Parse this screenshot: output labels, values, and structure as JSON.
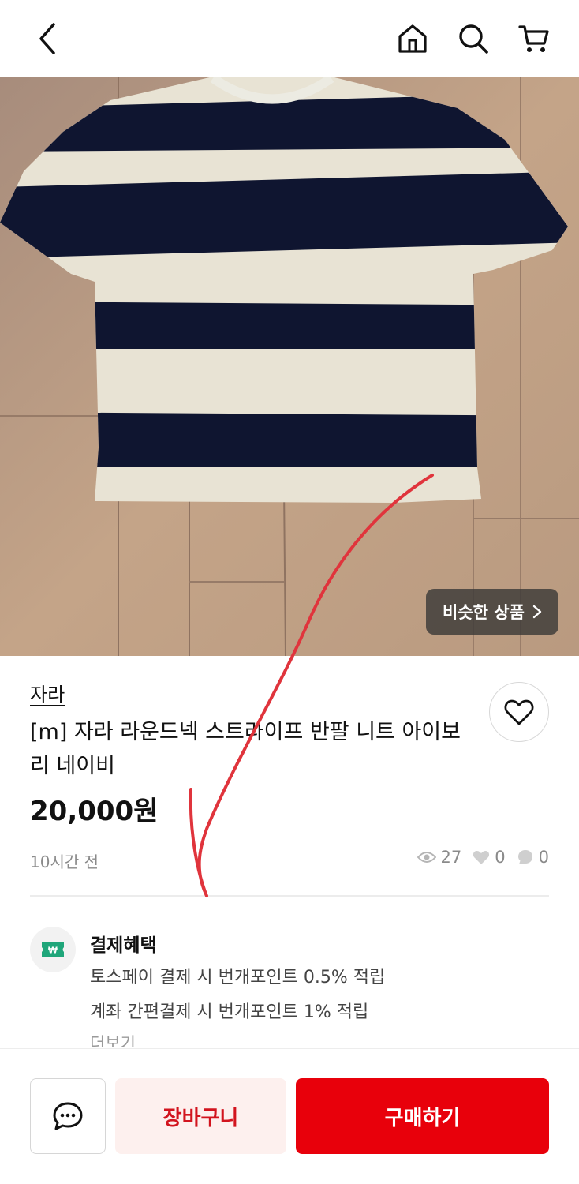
{
  "similar_products_label": "비슷한 상품",
  "product": {
    "brand": "자라",
    "title": "[m] 자라 라운드넥 스트라이프 반팔 니트 아이보리 네이비",
    "price": "20,000원",
    "posted": "10시간 전",
    "views": "27",
    "likes": "0",
    "comments": "0"
  },
  "payment": {
    "title": "결제혜택",
    "line1": "토스페이 결제 시 번개포인트 0.5% 적립",
    "line2": "계좌 간편결제 시 번개포인트 1% 적립",
    "more": "더보기"
  },
  "bottom": {
    "cart_label": "장바구니",
    "buy_label": "구매하기"
  },
  "icons": {
    "back": "chevron-left-icon",
    "home": "home-icon",
    "search": "search-icon",
    "cart": "cart-icon",
    "heart": "heart-icon",
    "chat": "chat-icon",
    "eye": "eye-icon",
    "comment": "comment-icon",
    "won": "won-ticket-icon"
  },
  "colors": {
    "accent": "#e8000b",
    "cart_bg": "#fdf0ee",
    "cart_text": "#d2141e",
    "benefit_green": "#1fa67a"
  }
}
